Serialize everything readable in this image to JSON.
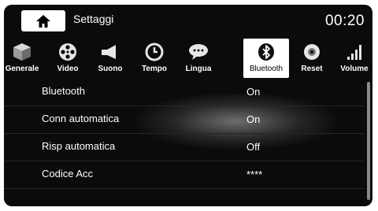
{
  "header": {
    "title": "Settaggi",
    "clock": "00:20",
    "home_icon": "home-icon"
  },
  "tabs": [
    {
      "label": "Generale",
      "icon": "cube-icon",
      "active": false
    },
    {
      "label": "Video",
      "icon": "film-reel-icon",
      "active": false
    },
    {
      "label": "Suono",
      "icon": "speaker-icon",
      "active": false
    },
    {
      "label": "Tempo",
      "icon": "clock-icon",
      "active": false
    },
    {
      "label": "Lingua",
      "icon": "speech-bubble-icon",
      "active": false
    },
    {
      "label": "Bluetooth",
      "icon": "bluetooth-icon",
      "active": true
    },
    {
      "label": "Reset",
      "icon": "disc-icon",
      "active": false
    },
    {
      "label": "Volume",
      "icon": "volume-bars-icon",
      "active": false
    }
  ],
  "settings": [
    {
      "name": "Bluetooth",
      "value": "On"
    },
    {
      "name": "Conn automatica",
      "value": "On"
    },
    {
      "name": "Risp automatica",
      "value": "Off"
    },
    {
      "name": "Codice Acc",
      "value": "****"
    }
  ]
}
